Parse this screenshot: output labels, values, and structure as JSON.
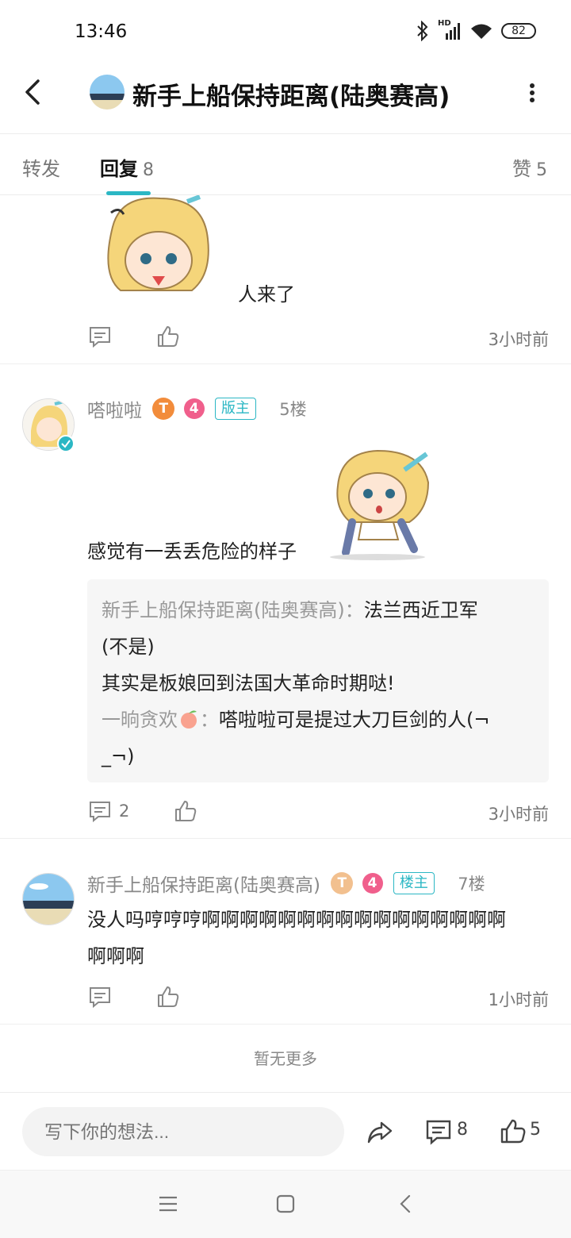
{
  "status": {
    "time": "13:46",
    "battery": "82",
    "network": "HD"
  },
  "header": {
    "title": "新手上船保持距离(陆奥赛高)"
  },
  "tabs": {
    "forward": {
      "label": "转发"
    },
    "reply": {
      "label": "回复",
      "count": "8"
    },
    "like": {
      "label": "赞",
      "count": "5"
    }
  },
  "posts": [
    {
      "text": "人来了",
      "time": "3小时前"
    },
    {
      "username": "嗒啦啦",
      "t_badge": "T",
      "level": "4",
      "role": "版主",
      "floor": "5楼",
      "text": "感觉有一丢丢危险的样子",
      "replies": [
        {
          "author": "新手上船保持距离(陆奥赛高)",
          "sep": "：",
          "text_1": "法兰西近卫军",
          "text_2": "(不是)",
          "text_3": "其实是板娘回到法国大革命时期哒!"
        },
        {
          "author": "一晌贪欢",
          "sep": "：",
          "text_1": "嗒啦啦可是提过大刀巨剑的人(¬",
          "text_2": "_¬)"
        }
      ],
      "comment_count": "2",
      "time": "3小时前"
    },
    {
      "username": "新手上船保持距离(陆奥赛高)",
      "t_badge": "T",
      "level": "4",
      "role": "楼主",
      "floor": "7楼",
      "text_1": "没人吗哼哼哼啊啊啊啊啊啊啊啊啊啊啊啊啊啊啊啊",
      "text_2": "啊啊啊",
      "time": "1小时前"
    }
  ],
  "footer_note": "暂无更多",
  "bottom_bar": {
    "placeholder": "写下你的想法...",
    "comment_count": "8",
    "like_count": "5"
  },
  "colors": {
    "accent": "#2bb7c4",
    "level_badge": "#f05f8c",
    "t_badge": "#f28c3b"
  }
}
